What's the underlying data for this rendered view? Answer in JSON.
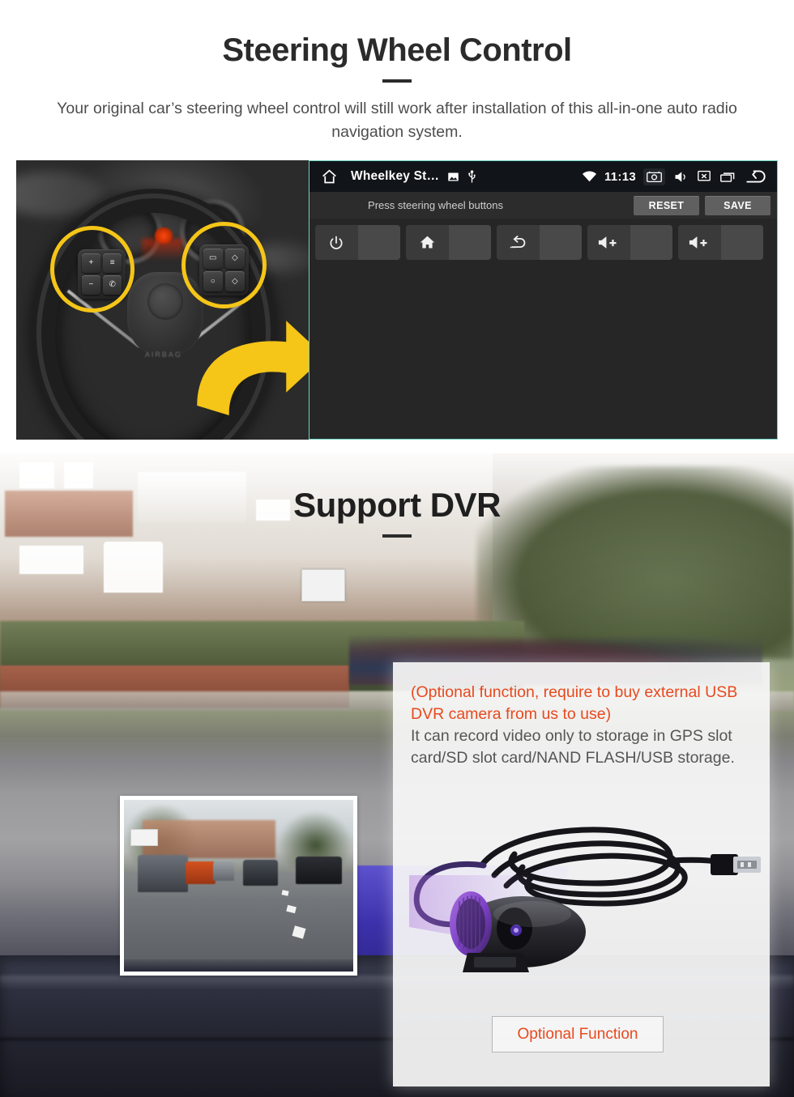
{
  "section1": {
    "title": "Steering Wheel Control",
    "subtitle": "Your original car’s steering wheel control will still work after installation of this all-in-one auto radio navigation system.",
    "head_unit": {
      "status_bar": {
        "home_icon": "home-icon",
        "app_title": "Wheelkey St…",
        "gallery_icon": "image-icon",
        "usb_icon": "usb-icon",
        "wifi_icon": "wifi-icon",
        "time": "11:13",
        "screenshot_icon": "camera-icon",
        "mute_icon": "volume-mute-icon",
        "screen_off_icon": "screen-off-icon",
        "recents_icon": "recent-apps-icon",
        "back_icon": "back-arrow-icon"
      },
      "prompt": "Press steering wheel buttons",
      "reset_label": "RESET",
      "save_label": "SAVE",
      "keys": [
        {
          "icon": "power-icon",
          "glyph": "⏻",
          "value": ""
        },
        {
          "icon": "home-icon",
          "glyph": "⌂",
          "value": ""
        },
        {
          "icon": "back-icon",
          "glyph": "↩",
          "value": ""
        },
        {
          "icon": "volume-up-icon",
          "glyph": "🔊+",
          "value": ""
        },
        {
          "icon": "volume-up-icon",
          "glyph": "🔊+",
          "value": ""
        }
      ],
      "border_color": "#6fd4c4"
    },
    "steering_photo": {
      "left_pod_buttons": [
        "+",
        "≡",
        "−",
        "✆"
      ],
      "right_pod_buttons": [
        "▭",
        "◇",
        "○",
        "◇"
      ],
      "highlight_color": "#f5c518",
      "arrow_color": "#f5c518",
      "hub_text": "AIRBAG"
    }
  },
  "section2": {
    "title": "Support DVR",
    "panel": {
      "highlight_text": "(Optional function, require to buy external USB DVR camera from us to use)",
      "body_text": "It can record video only to storage in GPS slot card/SD slot card/NAND FLASH/USB storage.",
      "highlight_color": "#e8491e",
      "body_color": "#555555",
      "button_label": "Optional Function"
    }
  }
}
